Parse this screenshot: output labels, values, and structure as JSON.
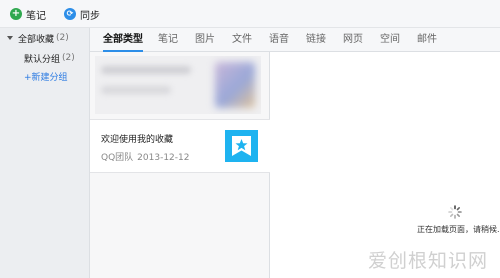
{
  "toolbar": {
    "note_label": "笔记",
    "sync_label": "同步"
  },
  "sidebar": {
    "all": {
      "label": "全部收藏",
      "count": "(2)"
    },
    "default_group": {
      "label": "默认分组",
      "count": "(2)"
    },
    "new_group": "+新建分组"
  },
  "tabs": [
    "全部类型",
    "笔记",
    "图片",
    "文件",
    "语音",
    "链接",
    "网页",
    "空间",
    "邮件"
  ],
  "list": {
    "item2": {
      "title": "欢迎使用我的收藏",
      "source": "QQ团队",
      "date": "2013-12-12"
    }
  },
  "preview": {
    "loading_text": "正在加载页面，请稍候..."
  },
  "watermark": "爱创根知识网",
  "colors": {
    "accent": "#2d8ee8",
    "note_icon": "#2fa84f",
    "fav_icon": "#1eb3f0",
    "link": "#2a7ae2"
  }
}
